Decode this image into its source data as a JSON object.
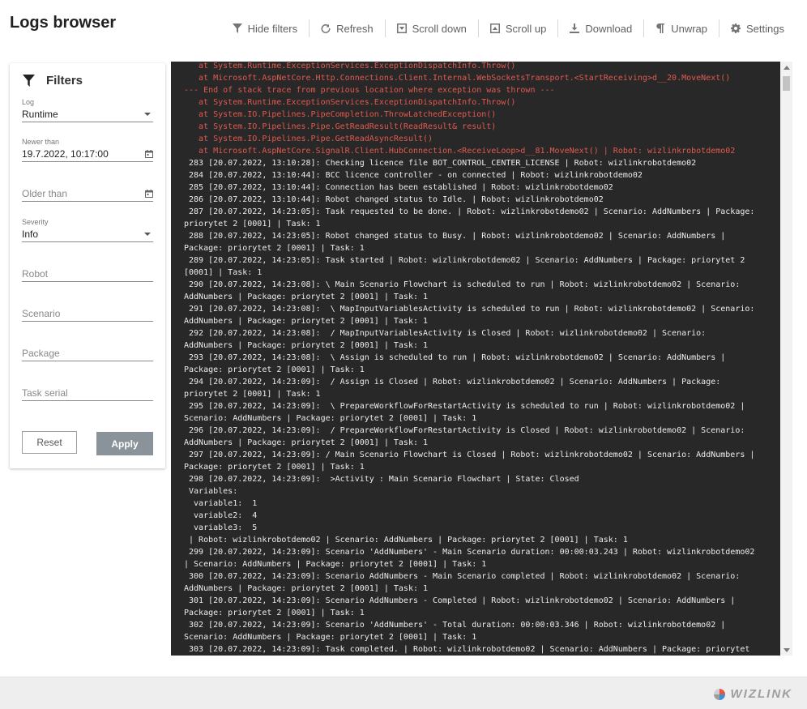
{
  "header": {
    "title": "Logs browser"
  },
  "toolbar": {
    "hide_filters": "Hide filters",
    "refresh": "Refresh",
    "scroll_down": "Scroll down",
    "scroll_up": "Scroll up",
    "download": "Download",
    "unwrap": "Unwrap",
    "settings": "Settings"
  },
  "filters": {
    "title": "Filters",
    "log_label": "Log",
    "log_value": "Runtime",
    "newer_label": "Newer than",
    "newer_value": "19.7.2022, 10:17:00",
    "older_placeholder": "Older than",
    "severity_label": "Severity",
    "severity_value": "Info",
    "robot_placeholder": "Robot",
    "scenario_placeholder": "Scenario",
    "package_placeholder": "Package",
    "task_serial_placeholder": "Task serial",
    "reset": "Reset",
    "apply": "Apply"
  },
  "log_lines": [
    {
      "t": "   at System.Runtime.ExceptionServices.ExceptionDispatchInfo.Throw()",
      "err": true
    },
    {
      "t": "   at Microsoft.AspNetCore.Http.Connections.Client.Internal.WebSocketsTransport.<StartReceiving>d__20.MoveNext()",
      "err": true
    },
    {
      "t": "--- End of stack trace from previous location where exception was thrown ---",
      "err": true
    },
    {
      "t": "   at System.Runtime.ExceptionServices.ExceptionDispatchInfo.Throw()",
      "err": true
    },
    {
      "t": "   at System.IO.Pipelines.PipeCompletion.ThrowLatchedException()",
      "err": true
    },
    {
      "t": "   at System.IO.Pipelines.Pipe.GetReadResult(ReadResult& result)",
      "err": true
    },
    {
      "t": "   at System.IO.Pipelines.Pipe.GetReadAsyncResult()",
      "err": true
    },
    {
      "t": "   at Microsoft.AspNetCore.SignalR.Client.HubConnection.<ReceiveLoop>d__81.MoveNext() | Robot: wizlinkrobotdemo02",
      "err": true
    },
    {
      "t": " 283 [20.07.2022, 13:10:28]: Checking licence file BOT_CONTROL_CENTER_LICENSE | Robot: wizlinkrobotdemo02",
      "err": false
    },
    {
      "t": " 284 [20.07.2022, 13:10:44]: BCC licence controller - on connected | Robot: wizlinkrobotdemo02",
      "err": false
    },
    {
      "t": " 285 [20.07.2022, 13:10:44]: Connection has been established | Robot: wizlinkrobotdemo02",
      "err": false
    },
    {
      "t": " 286 [20.07.2022, 13:10:44]: Robot changed status to Idle. | Robot: wizlinkrobotdemo02",
      "err": false
    },
    {
      "t": " 287 [20.07.2022, 14:23:05]: Task requested to be done. | Robot: wizlinkrobotdemo02 | Scenario: AddNumbers | Package:",
      "err": false
    },
    {
      "t": "priorytet 2 [0001] | Task: 1",
      "err": false
    },
    {
      "t": " 288 [20.07.2022, 14:23:05]: Robot changed status to Busy. | Robot: wizlinkrobotdemo02 | Scenario: AddNumbers |",
      "err": false
    },
    {
      "t": "Package: priorytet 2 [0001] | Task: 1",
      "err": false
    },
    {
      "t": " 289 [20.07.2022, 14:23:05]: Task started | Robot: wizlinkrobotdemo02 | Scenario: AddNumbers | Package: priorytet 2",
      "err": false
    },
    {
      "t": "[0001] | Task: 1",
      "err": false
    },
    {
      "t": " 290 [20.07.2022, 14:23:08]: \\ Main Scenario Flowchart is scheduled to run | Robot: wizlinkrobotdemo02 | Scenario:",
      "err": false
    },
    {
      "t": "AddNumbers | Package: priorytet 2 [0001] | Task: 1",
      "err": false
    },
    {
      "t": " 291 [20.07.2022, 14:23:08]:  \\ MapInputVariablesActivity is scheduled to run | Robot: wizlinkrobotdemo02 | Scenario:",
      "err": false
    },
    {
      "t": "AddNumbers | Package: priorytet 2 [0001] | Task: 1",
      "err": false
    },
    {
      "t": " 292 [20.07.2022, 14:23:08]:  / MapInputVariablesActivity is Closed | Robot: wizlinkrobotdemo02 | Scenario:",
      "err": false
    },
    {
      "t": "AddNumbers | Package: priorytet 2 [0001] | Task: 1",
      "err": false
    },
    {
      "t": " 293 [20.07.2022, 14:23:08]:  \\ Assign is scheduled to run | Robot: wizlinkrobotdemo02 | Scenario: AddNumbers |",
      "err": false
    },
    {
      "t": "Package: priorytet 2 [0001] | Task: 1",
      "err": false
    },
    {
      "t": " 294 [20.07.2022, 14:23:09]:  / Assign is Closed | Robot: wizlinkrobotdemo02 | Scenario: AddNumbers | Package:",
      "err": false
    },
    {
      "t": "priorytet 2 [0001] | Task: 1",
      "err": false
    },
    {
      "t": " 295 [20.07.2022, 14:23:09]:  \\ PrepareWorkflowForRestartActivity is scheduled to run | Robot: wizlinkrobotdemo02 |",
      "err": false
    },
    {
      "t": "Scenario: AddNumbers | Package: priorytet 2 [0001] | Task: 1",
      "err": false
    },
    {
      "t": " 296 [20.07.2022, 14:23:09]:  / PrepareWorkflowForRestartActivity is Closed | Robot: wizlinkrobotdemo02 | Scenario:",
      "err": false
    },
    {
      "t": "AddNumbers | Package: priorytet 2 [0001] | Task: 1",
      "err": false
    },
    {
      "t": " 297 [20.07.2022, 14:23:09]: / Main Scenario Flowchart is Closed | Robot: wizlinkrobotdemo02 | Scenario: AddNumbers |",
      "err": false
    },
    {
      "t": "Package: priorytet 2 [0001] | Task: 1",
      "err": false
    },
    {
      "t": " 298 [20.07.2022, 14:23:09]:  >Activity : Main Scenario Flowchart | State: Closed",
      "err": false
    },
    {
      "t": " Variables:",
      "err": false
    },
    {
      "t": "  variable1:  1",
      "err": false
    },
    {
      "t": "  variable2:  4",
      "err": false
    },
    {
      "t": "  variable3:  5",
      "err": false
    },
    {
      "t": " | Robot: wizlinkrobotdemo02 | Scenario: AddNumbers | Package: priorytet 2 [0001] | Task: 1",
      "err": false
    },
    {
      "t": " 299 [20.07.2022, 14:23:09]: Scenario 'AddNumbers' - Main Scenario duration: 00:00:03.243 | Robot: wizlinkrobotdemo02",
      "err": false
    },
    {
      "t": "| Scenario: AddNumbers | Package: priorytet 2 [0001] | Task: 1",
      "err": false
    },
    {
      "t": " 300 [20.07.2022, 14:23:09]: Scenario AddNumbers - Main Scenario completed | Robot: wizlinkrobotdemo02 | Scenario:",
      "err": false
    },
    {
      "t": "AddNumbers | Package: priorytet 2 [0001] | Task: 1",
      "err": false
    },
    {
      "t": " 301 [20.07.2022, 14:23:09]: Scenario AddNumbers - Completed | Robot: wizlinkrobotdemo02 | Scenario: AddNumbers |",
      "err": false
    },
    {
      "t": "Package: priorytet 2 [0001] | Task: 1",
      "err": false
    },
    {
      "t": " 302 [20.07.2022, 14:23:09]: Scenario 'AddNumbers' - Total duration: 00:00:03.346 | Robot: wizlinkrobotdemo02 |",
      "err": false
    },
    {
      "t": "Scenario: AddNumbers | Package: priorytet 2 [0001] | Task: 1",
      "err": false
    },
    {
      "t": " 303 [20.07.2022, 14:23:09]: Task completed. | Robot: wizlinkrobotdemo02 | Scenario: AddNumbers | Package: priorytet",
      "err": false
    }
  ],
  "footer": {
    "brand": "WIZLINK"
  },
  "colors": {
    "console_bg": "#282828",
    "log_text": "#ececec",
    "error_text": "#e05a4f",
    "apply_button": "#8a939a"
  }
}
